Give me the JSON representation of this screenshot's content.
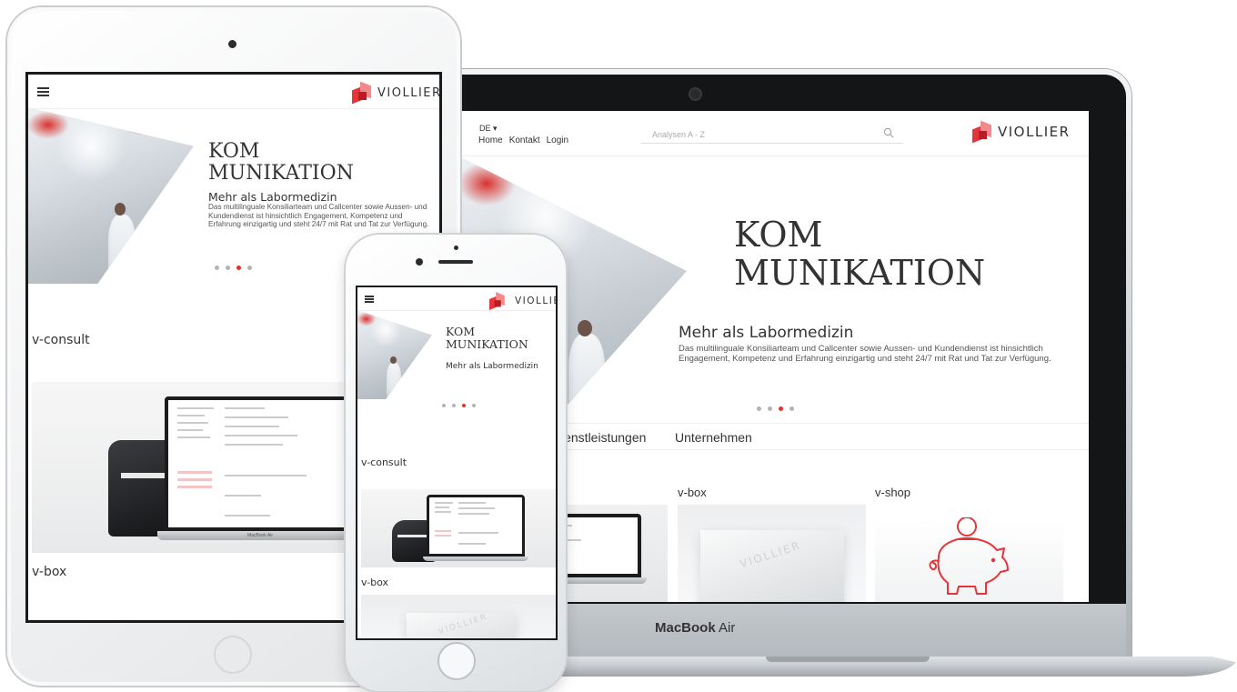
{
  "brand": {
    "name": "VIOLLIER",
    "red": "#e5343a",
    "pink": "#f28a8c",
    "dark_red": "#b91d23"
  },
  "macbook": {
    "device_label_bold": "MacBook",
    "device_label_rest": " Air",
    "header": {
      "language": "DE ▾",
      "nav": [
        "Home",
        "Kontakt",
        "Login"
      ],
      "search_placeholder": "Analysen A - Z"
    },
    "hero": {
      "title_line1": "KOM",
      "title_line2": "MUNIKATION",
      "subtitle": "Mehr als Labormedizin",
      "text": "Das multilinguale Konsiliarteam und Callcenter sowie Aussen- und Kundendienst ist hinsichtlich Engagement, Kompetenz und Erfahrung einzigartig und steht 24/7 mit Rat und Tat zur Verfügung.",
      "slides": 4,
      "active_slide": 3
    },
    "tabs": [
      "ienstleistungen",
      "Unternehmen"
    ],
    "cards": [
      {
        "label": "v-box"
      },
      {
        "label": "v-shop"
      }
    ],
    "cube_text": "VIOLLIER"
  },
  "ipad": {
    "hero": {
      "title_line1": "KOM",
      "title_line2": "MUNIKATION",
      "subtitle": "Mehr als Labormedizin",
      "text": "Das multilinguale Konsiliarteam und Callcenter sowie Aussen- und Kundendienst ist hinsichtlich Engagement, Kompetenz und Erfahrung einzigartig und steht 24/7 mit Rat und Tat zur Verfügung."
    },
    "sections": [
      "v-consult",
      "v-box"
    ],
    "mini_laptop_label": "MacBook Air"
  },
  "iphone": {
    "hero": {
      "title_line1": "KOM",
      "title_line2": "MUNIKATION",
      "subtitle": "Mehr als Labormedizin"
    },
    "sections": [
      "v-consult",
      "v-box"
    ]
  }
}
